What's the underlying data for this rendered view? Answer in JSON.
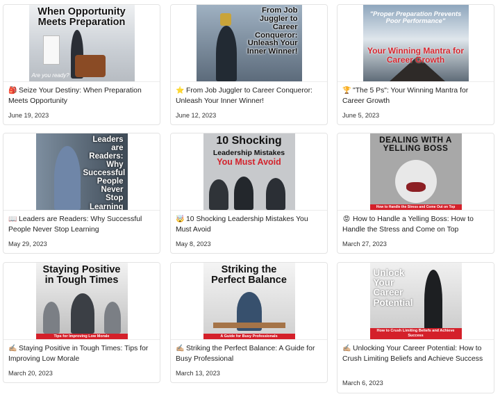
{
  "posts": [
    {
      "emoji": "🎒",
      "title": "Seize Your Destiny: When Preparation Meets Opportunity",
      "date": "June 19, 2023",
      "image_text": "When Opportunity Meets Preparation",
      "image_subtext": "Are you ready?"
    },
    {
      "emoji": "⭐",
      "title": "From Job Juggler to Career Conqueror: Unleash Your Inner Winner!",
      "date": "June 12, 2023",
      "image_text": "From Job Juggler to Career Conqueror: Unleash Your Inner Winner!"
    },
    {
      "emoji": "🏆",
      "title": "\"The 5 Ps\": Your Winning Mantra for Career Growth",
      "date": "June 5, 2023",
      "image_text": "\"Proper Preparation Prevents Poor Performance\"",
      "image_subtext": "Your Winning Mantra for Career Growth"
    },
    {
      "emoji": "📖",
      "title": "Leaders are Readers: Why Successful People Never Stop Learning",
      "date": "May 29, 2023",
      "image_text": "Leaders are Readers: Why Successful People Never Stop Learning"
    },
    {
      "emoji": "🤯",
      "title": "10 Shocking Leadership Mistakes You Must Avoid",
      "date": "May 8, 2023",
      "image_text": "10 Shocking",
      "image_text2": "Leadership Mistakes",
      "image_text3": "You Must Avoid"
    },
    {
      "emoji": "😡",
      "title": "How to Handle a Yelling Boss: How to Handle the Stress and Come on Top",
      "date": "March 27, 2023",
      "image_text": "DEALING WITH A YELLING BOSS",
      "image_subtext": "How to Handle the Stress and Come Out on Top"
    },
    {
      "emoji": "✍🏼",
      "title": "Staying Positive in Tough Times: Tips for Improving Low Morale",
      "date": "March 20, 2023",
      "image_text": "Staying Positive in Tough Times",
      "image_subtext": "Tips for Improving Low Morale"
    },
    {
      "emoji": "✍🏼",
      "title": "Striking the Perfect Balance: A Guide for Busy Professional",
      "date": "March 13, 2023",
      "image_text": "Striking the Perfect Balance",
      "image_subtext": "A Guide for Busy Professionals"
    },
    {
      "emoji": "✍🏼",
      "title": "Unlocking Your Career Potential: How to Crush Limiting Beliefs and Achieve Success",
      "date": "March 6, 2023",
      "image_text": "Unlock Your Career Potential",
      "image_subtext": "How to Crush Limiting Beliefs and Achieve Success"
    }
  ]
}
